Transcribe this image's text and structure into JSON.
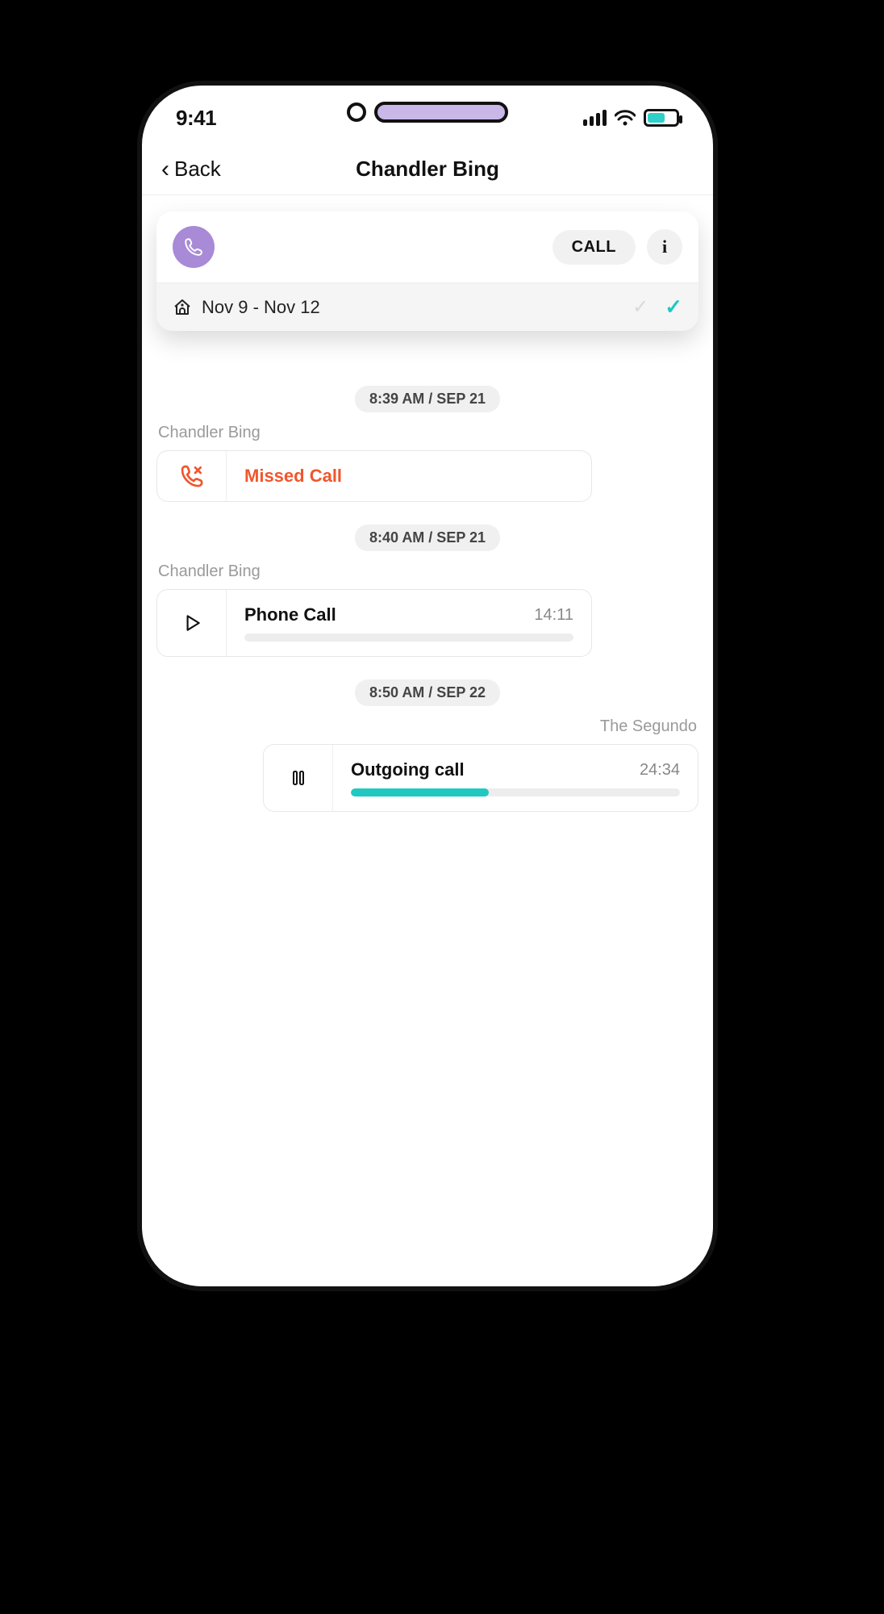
{
  "status": {
    "time": "9:41"
  },
  "nav": {
    "back_label": "Back",
    "title": "Chandler Bing"
  },
  "contact": {
    "call_button_label": "CALL",
    "info_button_label": "i",
    "date_range": "Nov 9 - Nov 12"
  },
  "timeline": [
    {
      "timestamp": "8:39 AM / SEP 21",
      "sender": "Chandler Bing",
      "side": "left",
      "type": "missed",
      "title": "Missed Call"
    },
    {
      "timestamp": "8:40 AM / SEP 21",
      "sender": "Chandler Bing",
      "side": "left",
      "type": "play",
      "title": "Phone Call",
      "duration": "14:11",
      "progress_pct": 0
    },
    {
      "timestamp": "8:50 AM / SEP 22",
      "sender": "The Segundo",
      "side": "right",
      "type": "pause",
      "title": "Outgoing call",
      "duration": "24:34",
      "progress_pct": 42
    }
  ],
  "colors": {
    "accent_teal": "#1fc9c1",
    "accent_purple": "#a88ad6",
    "missed_orange": "#f0562c"
  }
}
